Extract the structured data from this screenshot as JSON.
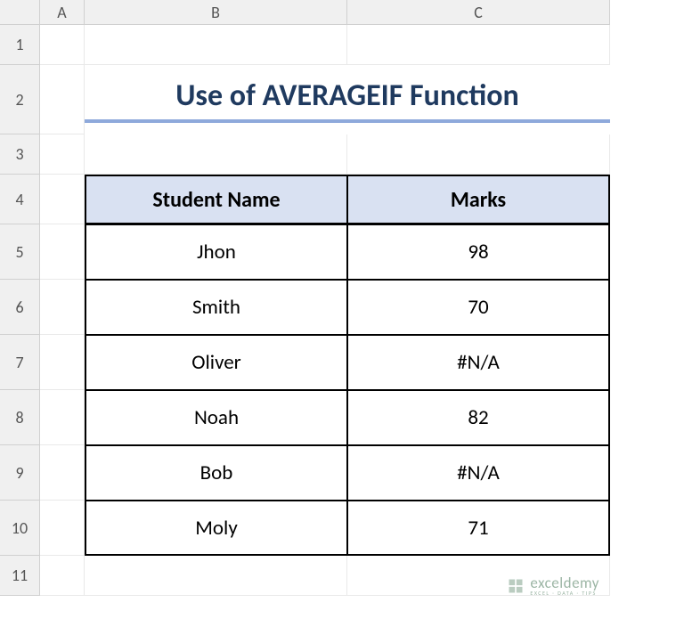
{
  "columns": [
    "A",
    "B",
    "C"
  ],
  "rows": [
    "1",
    "2",
    "3",
    "4",
    "5",
    "6",
    "7",
    "8",
    "9",
    "10",
    "11"
  ],
  "title": "Use of AVERAGEIF Function",
  "table": {
    "headers": [
      "Student Name",
      "Marks"
    ],
    "data": [
      {
        "name": "Jhon",
        "marks": "98"
      },
      {
        "name": "Smith",
        "marks": "70"
      },
      {
        "name": "Oliver",
        "marks": "#N/A"
      },
      {
        "name": "Noah",
        "marks": "82"
      },
      {
        "name": "Bob",
        "marks": "#N/A"
      },
      {
        "name": "Moly",
        "marks": "71"
      }
    ]
  },
  "watermark": {
    "main": "exceldemy",
    "sub": "EXCEL · DATA · TIPS"
  },
  "chart_data": {
    "type": "table",
    "title": "Use of AVERAGEIF Function",
    "columns": [
      "Student Name",
      "Marks"
    ],
    "rows": [
      [
        "Jhon",
        98
      ],
      [
        "Smith",
        70
      ],
      [
        "Oliver",
        "#N/A"
      ],
      [
        "Noah",
        82
      ],
      [
        "Bob",
        "#N/A"
      ],
      [
        "Moly",
        71
      ]
    ]
  }
}
